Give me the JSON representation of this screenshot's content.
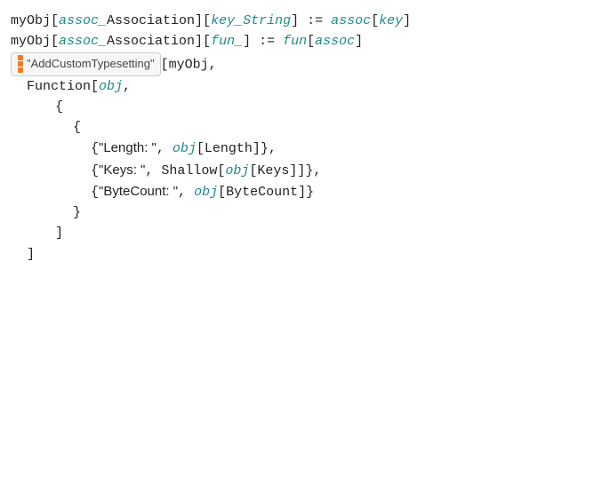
{
  "line1": {
    "p1": "myObj[",
    "assoc": "assoc_",
    "p2": "Association][",
    "key": "key_String",
    "p3": "] := ",
    "assoc2": "assoc",
    "p4": "[",
    "key2": "key",
    "p5": "]"
  },
  "line2": {
    "p1": "myObj[",
    "assoc": "assoc_",
    "p2": "Association][",
    "fun": "fun_",
    "p3": "] := ",
    "fun2": "fun",
    "p4": "[",
    "assoc2": "assoc",
    "p5": "]"
  },
  "resource": {
    "label": "\"AddCustomTypesetting\"",
    "after": "[myObj,"
  },
  "line4": {
    "p1": "Function[",
    "obj": "obj",
    "p2": ","
  },
  "line5": "{",
  "line6": "{",
  "row1": {
    "label": "\"Length: \"",
    "mid": ", ",
    "obj": "obj",
    "after": "[Length]},",
    "brace": "{"
  },
  "row2": {
    "label": "\"Keys: \"",
    "mid": ", Shallow[",
    "obj": "obj",
    "after": "[Keys]]},",
    "brace": "{"
  },
  "row3": {
    "label": "\"ByteCount: \"",
    "mid": ", ",
    "obj": "obj",
    "after": "[ByteCount]}",
    "brace": "{"
  },
  "line10": "}",
  "line11": "]",
  "line12": "]"
}
